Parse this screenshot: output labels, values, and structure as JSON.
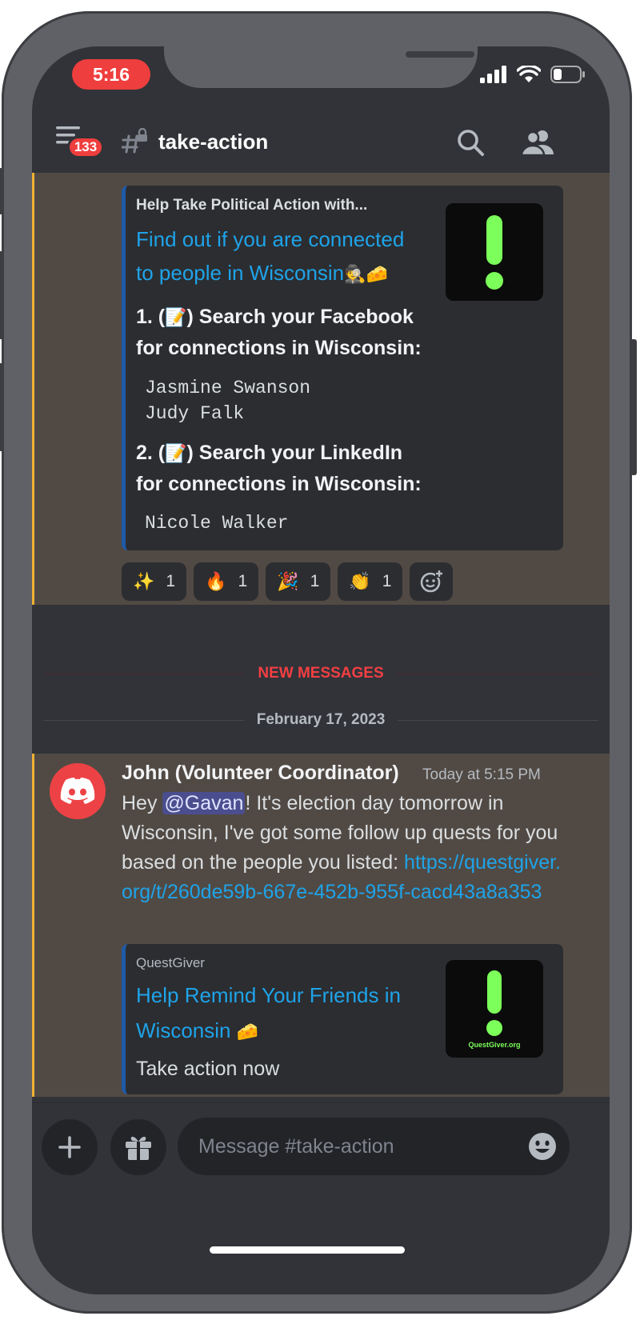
{
  "status_bar": {
    "time": "5:16"
  },
  "header": {
    "unread_count": "133",
    "channel_name": "take-action"
  },
  "embed1": {
    "provider": "Help Take Political Action with...",
    "title_line1": "Find out if you are connected",
    "title_line2": "to people in Wisconsin",
    "title_emojis": "🕵️🧀",
    "step1_prefix": "1. (",
    "step1_emoji": "📝",
    "step1_line1_suffix": ") Search your Facebook",
    "step1_line2": "for connections in Wisconsin:",
    "step1_names": [
      "Jasmine Swanson",
      "Judy Falk"
    ],
    "step2_prefix": "2. (",
    "step2_emoji": "📝",
    "step2_line1_suffix": ") Search your LinkedIn",
    "step2_line2": "for connections in Wisconsin:",
    "step2_names": [
      "Nicole Walker"
    ]
  },
  "reactions": [
    {
      "emoji": "✨",
      "count": "1"
    },
    {
      "emoji": "🔥",
      "count": "1"
    },
    {
      "emoji": "🎉",
      "count": "1"
    },
    {
      "emoji": "👏",
      "count": "1"
    }
  ],
  "dividers": {
    "new_messages": "NEW MESSAGES",
    "date": "February 17, 2023"
  },
  "message": {
    "author": "John (Volunteer Coordinator)",
    "timestamp": "Today at 5:15 PM",
    "text_before_mention": "Hey ",
    "mention": "@Gavan",
    "text_after_mention": "! It's election day tomorrow in Wisconsin, I've got some follow up quests for you based on the people you listed: ",
    "link": "https://questgiver.org/t/260de59b-667e-452b-955f-cacd43a8a353"
  },
  "embed2": {
    "provider": "QuestGiver",
    "title_line1": "Help Remind Your Friends in",
    "title_line2": "Wisconsin",
    "title_emoji": "🧀",
    "description": "Take action now",
    "thumb_caption": "QuestGiver.org"
  },
  "composer": {
    "placeholder": "Message #take-action"
  },
  "colors": {
    "accent_link": "#1fa3e8",
    "mention_bg": "#4b4e8e",
    "new_messages_red": "#f23f43",
    "highlight_bar": "#f0b132",
    "thumbnail_icon": "#7cff5a"
  }
}
